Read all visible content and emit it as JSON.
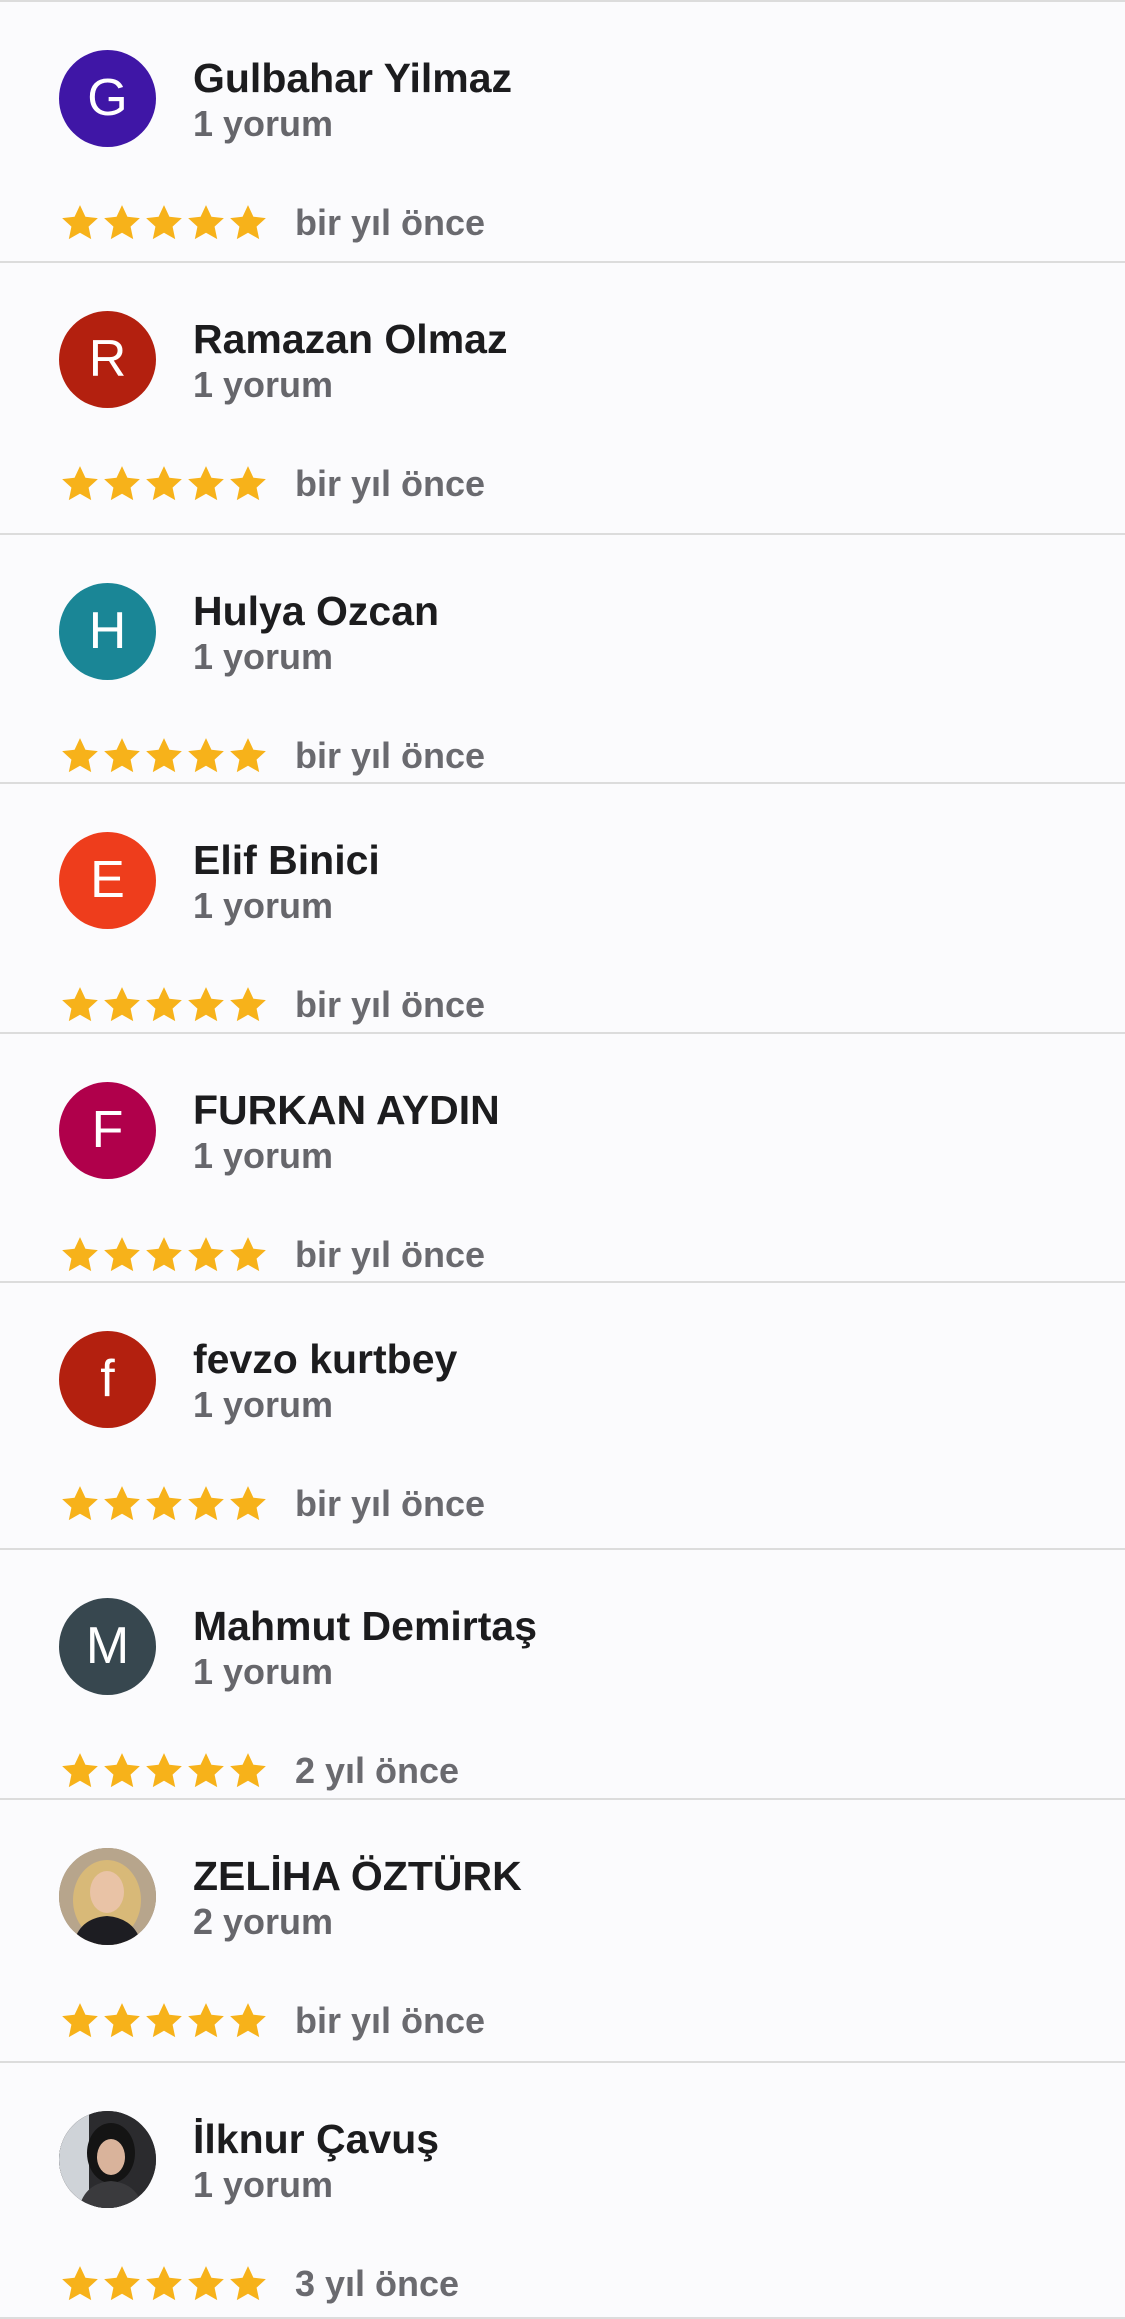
{
  "reviews": [
    {
      "initial": "G",
      "name": "Gulbahar Yilmaz",
      "review_count": "1 yorum",
      "rating": 5,
      "time_ago": "bir yıl önce",
      "avatar_color": "#3f16a6",
      "avatar_icon": "letter"
    },
    {
      "initial": "R",
      "name": "Ramazan Olmaz",
      "review_count": "1 yorum",
      "rating": 5,
      "time_ago": "bir yıl önce",
      "avatar_color": "#b3200f",
      "avatar_icon": "letter"
    },
    {
      "initial": "H",
      "name": "Hulya Ozcan",
      "review_count": "1 yorum",
      "rating": 5,
      "time_ago": "bir yıl önce",
      "avatar_color": "#1a8696",
      "avatar_icon": "letter"
    },
    {
      "initial": "E",
      "name": "Elif Binici",
      "review_count": "1 yorum",
      "rating": 5,
      "time_ago": "bir yıl önce",
      "avatar_color": "#ee3d1c",
      "avatar_icon": "letter"
    },
    {
      "initial": "F",
      "name": "FURKAN AYDIN",
      "review_count": "1 yorum",
      "rating": 5,
      "time_ago": "bir yıl önce",
      "avatar_color": "#b0004b",
      "avatar_icon": "letter"
    },
    {
      "initial": "f",
      "name": "fevzo kurtbey",
      "review_count": "1 yorum",
      "rating": 5,
      "time_ago": "bir yıl önce",
      "avatar_color": "#b3200f",
      "avatar_icon": "letter"
    },
    {
      "initial": "M",
      "name": "Mahmut Demirtaş",
      "review_count": "1 yorum",
      "rating": 5,
      "time_ago": "2 yıl önce",
      "avatar_color": "#37474f",
      "avatar_icon": "letter"
    },
    {
      "initial": "",
      "name": "ZELİHA ÖZTÜRK",
      "review_count": "2 yorum",
      "rating": 5,
      "time_ago": "bir yıl önce",
      "avatar_color": "#8c7a66",
      "avatar_icon": "profile-photo"
    },
    {
      "initial": "",
      "name": "İlknur Çavuş",
      "review_count": "1 yorum",
      "rating": 5,
      "time_ago": "3 yıl önce",
      "avatar_color": "#2b2b2e",
      "avatar_icon": "profile-photo"
    }
  ],
  "star_color": "#f7b21a"
}
